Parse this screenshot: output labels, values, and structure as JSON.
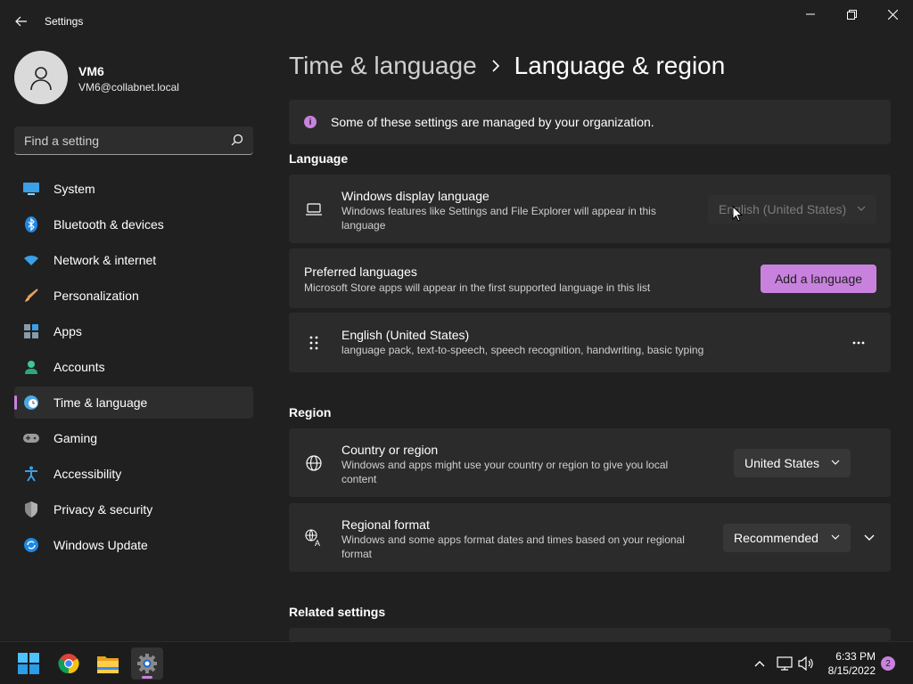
{
  "window": {
    "title": "Settings"
  },
  "user": {
    "name": "VM6",
    "email": "VM6@collabnet.local"
  },
  "search": {
    "placeholder": "Find a setting"
  },
  "sidebar": {
    "items": [
      {
        "label": "System",
        "icon": "monitor-icon"
      },
      {
        "label": "Bluetooth & devices",
        "icon": "bluetooth-icon"
      },
      {
        "label": "Network & internet",
        "icon": "wifi-icon"
      },
      {
        "label": "Personalization",
        "icon": "brush-icon"
      },
      {
        "label": "Apps",
        "icon": "apps-icon"
      },
      {
        "label": "Accounts",
        "icon": "person-icon"
      },
      {
        "label": "Time & language",
        "icon": "clock-globe-icon",
        "active": true
      },
      {
        "label": "Gaming",
        "icon": "gamepad-icon"
      },
      {
        "label": "Accessibility",
        "icon": "accessibility-icon"
      },
      {
        "label": "Privacy & security",
        "icon": "shield-icon"
      },
      {
        "label": "Windows Update",
        "icon": "update-icon"
      }
    ]
  },
  "breadcrumb": {
    "parent": "Time & language",
    "current": "Language & region"
  },
  "notice": {
    "text": "Some of these settings are managed by your organization.",
    "icon_glyph": "i"
  },
  "language": {
    "section_title": "Language",
    "display_language": {
      "title": "Windows display language",
      "description": "Windows features like Settings and File Explorer will appear in this language",
      "value": "English (United States)"
    },
    "preferred": {
      "title": "Preferred languages",
      "description": "Microsoft Store apps will appear in the first supported language in this list",
      "button": "Add a language"
    },
    "installed": [
      {
        "name": "English (United States)",
        "features": "language pack, text-to-speech, speech recognition, handwriting, basic typing"
      }
    ]
  },
  "region": {
    "section_title": "Region",
    "country": {
      "title": "Country or region",
      "description": "Windows and apps might use your country or region to give you local content",
      "value": "United States"
    },
    "format": {
      "title": "Regional format",
      "description": "Windows and some apps format dates and times based on your regional format",
      "value": "Recommended"
    }
  },
  "related": {
    "section_title": "Related settings"
  },
  "taskbar": {
    "time": "6:33 PM",
    "date": "8/15/2022",
    "notifications": "2",
    "apps": [
      "windows-start-icon",
      "chrome-icon",
      "file-explorer-icon",
      "settings-gear-icon"
    ]
  },
  "colors": {
    "accent": "#c882de",
    "background": "#202020",
    "card": "#2b2b2b"
  }
}
